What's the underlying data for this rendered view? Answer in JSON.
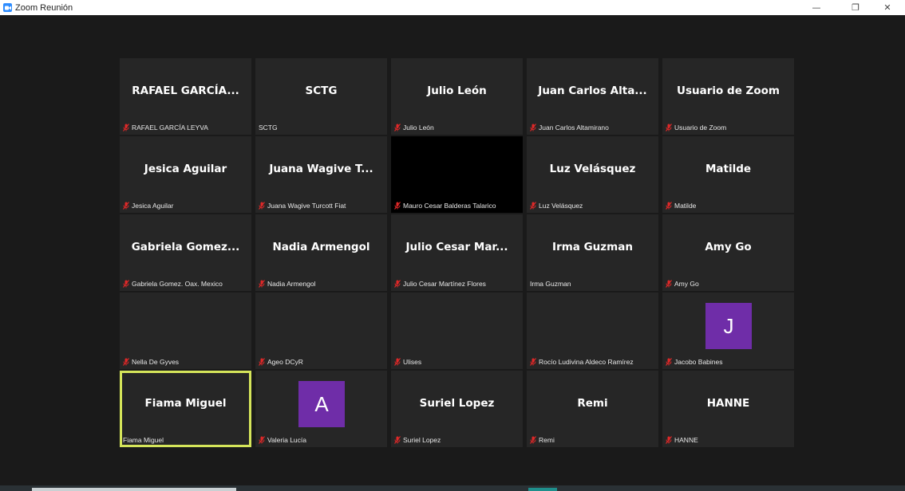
{
  "window": {
    "title": "Zoom Reunión",
    "minimize_glyph": "—",
    "restore_glyph": "❐",
    "close_glyph": "✕"
  },
  "colors": {
    "tile_bg": "#262626",
    "active_border": "#d5e55a",
    "mic_muted": "#e02828",
    "avatar_purple": "#6f2da8"
  },
  "participants": [
    {
      "display": "RAFAEL  GARCÍA...",
      "label": "RAFAEL GARCÍA LEYVA",
      "muted": true
    },
    {
      "display": "SCTG",
      "label": "SCTG",
      "muted": false
    },
    {
      "display": "Julio León",
      "label": "Julio León",
      "muted": true
    },
    {
      "display": "Juan Carlos Alta...",
      "label": "Juan Carlos Altamirano",
      "muted": true
    },
    {
      "display": "Usuario de Zoom",
      "label": "Usuario de Zoom",
      "muted": true
    },
    {
      "display": "Jesica Aguilar",
      "label": "Jesica Aguilar",
      "muted": true
    },
    {
      "display": "Juana Wagive T...",
      "label": "Juana Wagive Turcott Fiat",
      "muted": true
    },
    {
      "display": "",
      "label": "Mauro Cesar Balderas Talarico",
      "muted": true,
      "video": "black"
    },
    {
      "display": "Luz Velásquez",
      "label": "Luz Velásquez",
      "muted": true
    },
    {
      "display": "Matilde",
      "label": "Matilde",
      "muted": true
    },
    {
      "display": "Gabriela  Gomez...",
      "label": "Gabriela Gomez. Oax. Mexico",
      "muted": true
    },
    {
      "display": "Nadia Armengol",
      "label": "Nadia Armengol",
      "muted": true
    },
    {
      "display": "Julio  Cesar  Mar...",
      "label": "Julio Cesar Martínez Flores",
      "muted": true
    },
    {
      "display": "Irma Guzman",
      "label": "Irma Guzman",
      "muted": false
    },
    {
      "display": "Amy Go",
      "label": "Amy Go",
      "muted": true
    },
    {
      "display": "",
      "label": "Nella De Gyves",
      "muted": true
    },
    {
      "display": "",
      "label": "Ageo DCyR",
      "muted": true
    },
    {
      "display": "",
      "label": "Ulises",
      "muted": true
    },
    {
      "display": "",
      "label": "Rocío Ludivina Aldeco Ramírez",
      "muted": true
    },
    {
      "display": "",
      "label": "Jacobo Babines",
      "muted": true,
      "avatar": "J"
    },
    {
      "display": "Fiama Miguel",
      "label": "Fiama Miguel",
      "muted": false,
      "active": true
    },
    {
      "display": "",
      "label": "Valeria Lucía",
      "muted": true,
      "avatar": "A"
    },
    {
      "display": "Suriel Lopez",
      "label": "Suriel Lopez",
      "muted": true
    },
    {
      "display": "Remi",
      "label": "Remi",
      "muted": true
    },
    {
      "display": "HANNE",
      "label": "HANNE",
      "muted": true
    }
  ]
}
